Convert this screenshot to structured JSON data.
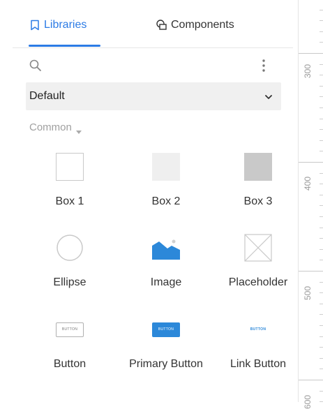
{
  "tabs": [
    {
      "label": "Libraries",
      "icon": "bookmark-icon",
      "active": true
    },
    {
      "label": "Components",
      "icon": "components-icon",
      "active": false
    }
  ],
  "search": {
    "icon": "search-icon",
    "more_icon": "more-vertical-icon"
  },
  "library_select": {
    "value": "Default"
  },
  "section": {
    "label": "Common"
  },
  "items": [
    {
      "label": "Box 1"
    },
    {
      "label": "Box 2"
    },
    {
      "label": "Box 3"
    },
    {
      "label": "Ellipse"
    },
    {
      "label": "Image"
    },
    {
      "label": "Placeholder"
    },
    {
      "label": "Button",
      "thumb_text": "BUTTON"
    },
    {
      "label": "Primary Button",
      "thumb_text": "BUTTON"
    },
    {
      "label": "Link Button",
      "thumb_text": "BUTTON"
    }
  ],
  "ruler": {
    "labels": [
      "300",
      "400",
      "500",
      "600"
    ]
  },
  "colors": {
    "accent": "#2c7be5",
    "primary_button": "#2c88d9"
  }
}
